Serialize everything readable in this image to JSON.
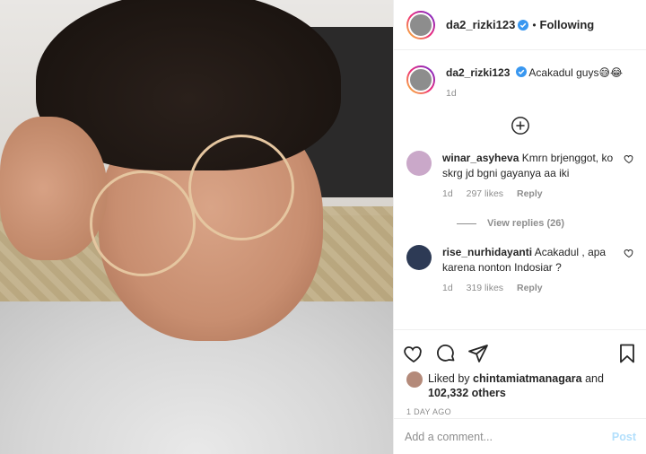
{
  "post": {
    "username": "da2_rizki123",
    "follow_status": "Following",
    "separator": "•",
    "caption_text": "Acakadul guys😅😂",
    "caption_age": "1d"
  },
  "comments": [
    {
      "username": "winar_asyheva",
      "text": "Kmrn brjenggot, ko skrg jd bgni gayanya aa iki",
      "age": "1d",
      "likes": "297 likes",
      "reply": "Reply",
      "view_replies": "View replies (26)"
    },
    {
      "username": "rise_nurhidayanti",
      "text": "Acakadul , apa karena nonton Indosiar ?",
      "age": "1d",
      "likes": "319 likes",
      "reply": "Reply"
    }
  ],
  "likes": {
    "prefix": "Liked by",
    "user": "chintamiatmanagara",
    "and": "and",
    "others": "102,332 others"
  },
  "time_ago": "1 DAY AGO",
  "add_comment": {
    "placeholder": "Add a comment...",
    "post_label": "Post"
  },
  "colors": {
    "verified": "#3897f0",
    "post_disabled": "#b2dffc",
    "muted": "#8e8e8e"
  },
  "icons": [
    "plus-circle-icon",
    "heart-icon",
    "comment-icon",
    "share-icon",
    "bookmark-icon",
    "verified-icon"
  ]
}
